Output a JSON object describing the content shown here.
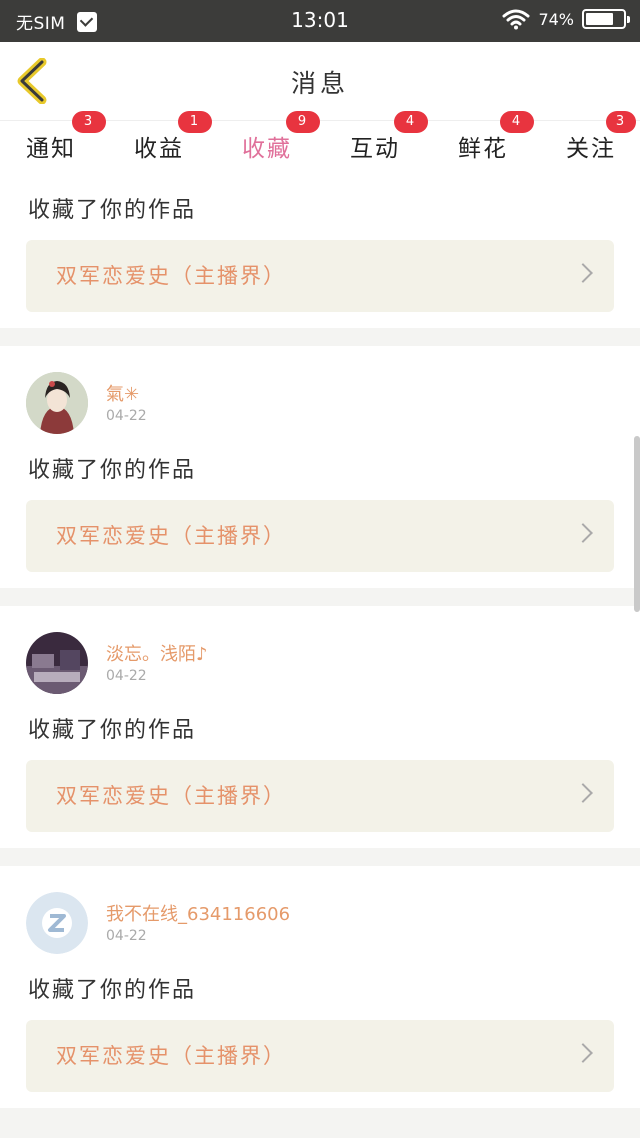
{
  "status_bar": {
    "sim": "无SIM",
    "time": "13:01",
    "battery": "74%",
    "battery_level": 0.74
  },
  "header": {
    "title": "消息"
  },
  "tabs": [
    {
      "label": "通知",
      "badge": "3"
    },
    {
      "label": "收益",
      "badge": "1"
    },
    {
      "label": "收藏",
      "badge": "9",
      "active": true
    },
    {
      "label": "互动",
      "badge": "4"
    },
    {
      "label": "鲜花",
      "badge": "4"
    },
    {
      "label": "关注",
      "badge": "3"
    }
  ],
  "messages": [
    {
      "action": "收藏了你的作品",
      "work": "双军恋爱史（主播界）"
    },
    {
      "name": "氣✳",
      "date": "04-22",
      "action": "收藏了你的作品",
      "work": "双军恋爱史（主播界）"
    },
    {
      "name": "淡忘。浅陌♪",
      "date": "04-22",
      "action": "收藏了你的作品",
      "work": "双军恋爱史（主播界）"
    },
    {
      "name": "我不在线_634116606",
      "date": "04-22",
      "action": "收藏了你的作品",
      "work": "双军恋爱史（主播界）"
    }
  ]
}
